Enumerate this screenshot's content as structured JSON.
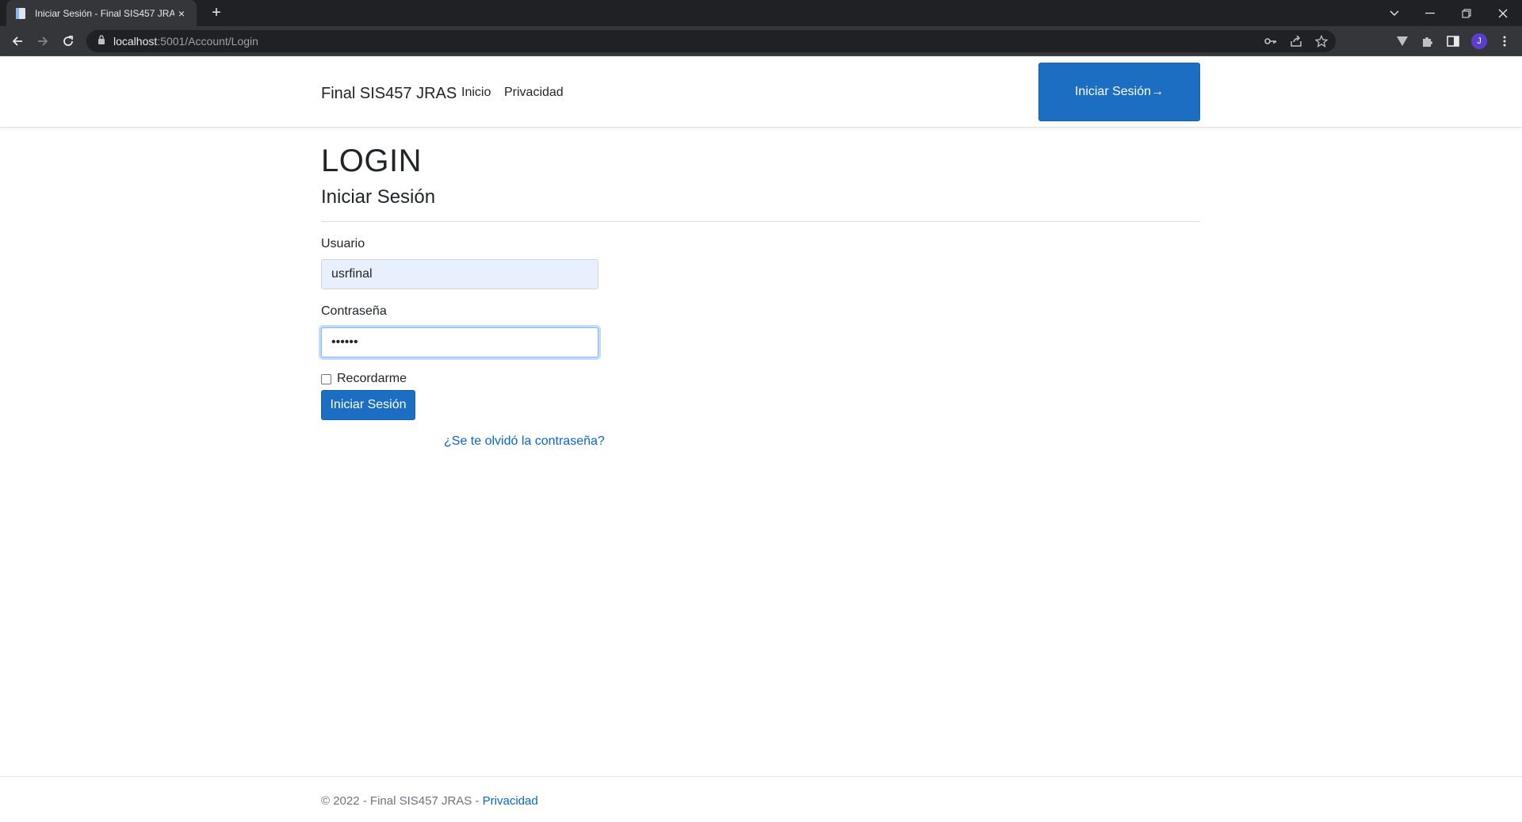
{
  "browser": {
    "tab_title": "Iniciar Sesión - Final SIS457 JRAS",
    "tab_close": "×",
    "new_tab": "+",
    "url_host": "localhost",
    "url_rest": ":5001/Account/Login",
    "avatar_letter": "J"
  },
  "navbar": {
    "brand": "Final SIS457 JRAS",
    "links": [
      "Inicio",
      "Privacidad"
    ],
    "login_button": "Iniciar Sesión→"
  },
  "main": {
    "title": "LOGIN",
    "subtitle": "Iniciar Sesión",
    "username_label": "Usuario",
    "username_value": "usrfinal",
    "password_label": "Contraseña",
    "password_value": "••••••",
    "remember_label": "Recordarme",
    "submit_label": "Iniciar Sesión",
    "forgot_link": "¿Se te olvidó la contraseña?"
  },
  "footer": {
    "text": "© 2022 - Final SIS457 JRAS - ",
    "link": "Privacidad"
  },
  "colors": {
    "primary": "#1b6ec2",
    "link": "#0366d6",
    "autofill": "#e8f0fe"
  }
}
